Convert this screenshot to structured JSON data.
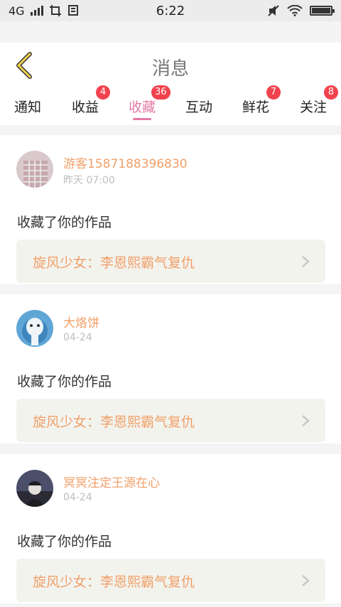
{
  "status_bar": {
    "network": "4G",
    "time": "6:22"
  },
  "header": {
    "title": "消息",
    "back_icon": "chevron-left-icon"
  },
  "tabs": [
    {
      "label": "通知",
      "badge": ""
    },
    {
      "label": "收益",
      "badge": "4"
    },
    {
      "label": "收藏",
      "badge": "36",
      "active": true
    },
    {
      "label": "互动",
      "badge": ""
    },
    {
      "label": "鲜花",
      "badge": "7"
    },
    {
      "label": "关注",
      "badge": "8"
    }
  ],
  "colors": {
    "accent_pink": "#e57ba6",
    "name_orange": "#f0a06a",
    "badge_red": "#f2424d"
  },
  "items": [
    {
      "user": "游客1587188396830",
      "time": "昨天 07:00",
      "action": "收藏了你的作品",
      "work_title": "旋风少女：李恩熙霸气复仇"
    },
    {
      "user": "大烙饼",
      "time": "04-24",
      "action": "收藏了你的作品",
      "work_title": "旋风少女：李恩熙霸气复仇"
    },
    {
      "user": "冥冥注定王源在心",
      "time": "04-24",
      "action": "收藏了你的作品",
      "work_title": "旋风少女：李恩熙霸气复仇"
    }
  ]
}
